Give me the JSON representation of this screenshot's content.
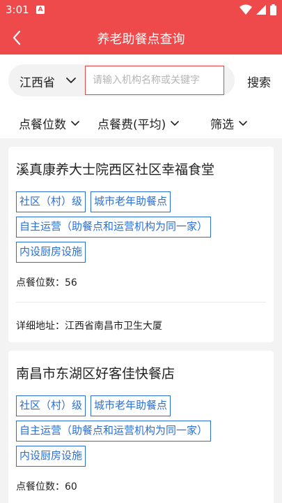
{
  "status_bar": {
    "time": "3:01",
    "notification_icon": "A"
  },
  "app_bar": {
    "title": "养老助餐点查询"
  },
  "search": {
    "province": "江西省",
    "placeholder": "请输入机构名称或关键字",
    "button": "搜索"
  },
  "filters": [
    {
      "label": "点餐位数"
    },
    {
      "label": "点餐费(平均)"
    },
    {
      "label": "筛选"
    }
  ],
  "cards": [
    {
      "title": "溪真康养大士院西区社区幸福食堂",
      "tags": [
        "社区（村）级",
        "城市老年助餐点",
        "自主运营（助餐点和运营机构为同一家）",
        "内设厨房设施"
      ],
      "seats": "点餐位数：56",
      "address": "详细地址：江西省南昌市卫生大厦"
    },
    {
      "title": "南昌市东湖区好客佳快餐店",
      "tags": [
        "社区（村）级",
        "城市老年助餐点",
        "自主运营（助餐点和运营机构为同一家）",
        "内设厨房设施"
      ],
      "seats": "点餐位数：60"
    }
  ],
  "colors": {
    "brand_red": "#ee4a4b",
    "tag_blue": "#2a6fd6",
    "input_border": "#e14848"
  },
  "icons": {
    "back": "back-arrow-icon",
    "dropdown": "chevron-down-icon",
    "wifi": "wifi-icon",
    "signal": "signal-icon",
    "battery": "battery-icon"
  }
}
